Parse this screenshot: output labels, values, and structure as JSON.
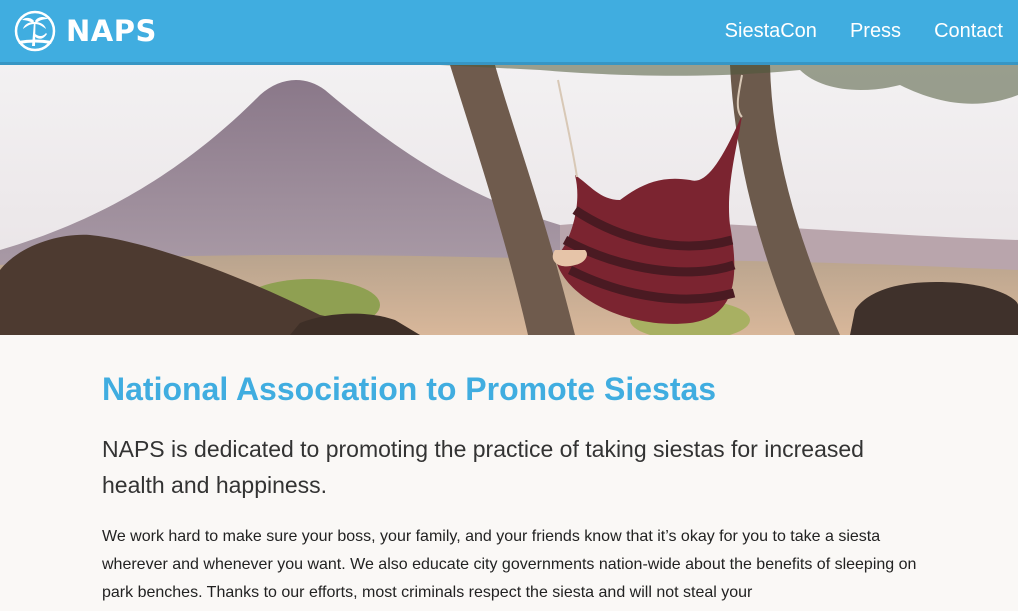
{
  "header": {
    "brand": "NAPS",
    "nav": [
      {
        "label": "SiestaCon"
      },
      {
        "label": "Press"
      },
      {
        "label": "Contact"
      }
    ]
  },
  "hero": {
    "alt": "Person relaxing in a hammock between two trees with a volcano in the background"
  },
  "main": {
    "title": "National Association to Promote Siestas",
    "lead": "NAPS is dedicated to promoting the practice of taking siestas for increased health and happiness.",
    "body": "We work hard to make sure your boss, your family, and your friends know that it’s okay for you to take a siesta wherever and whenever you want. We also educate city governments nation-wide about the benefits of sleeping on park benches. Thanks to our efforts, most criminals respect the siesta and will not steal your"
  },
  "colors": {
    "brand": "#40ade0",
    "header_border": "#3796c4",
    "page_bg": "#faf8f6"
  },
  "icons": {
    "logo": "palm-tree-hammock-icon"
  }
}
